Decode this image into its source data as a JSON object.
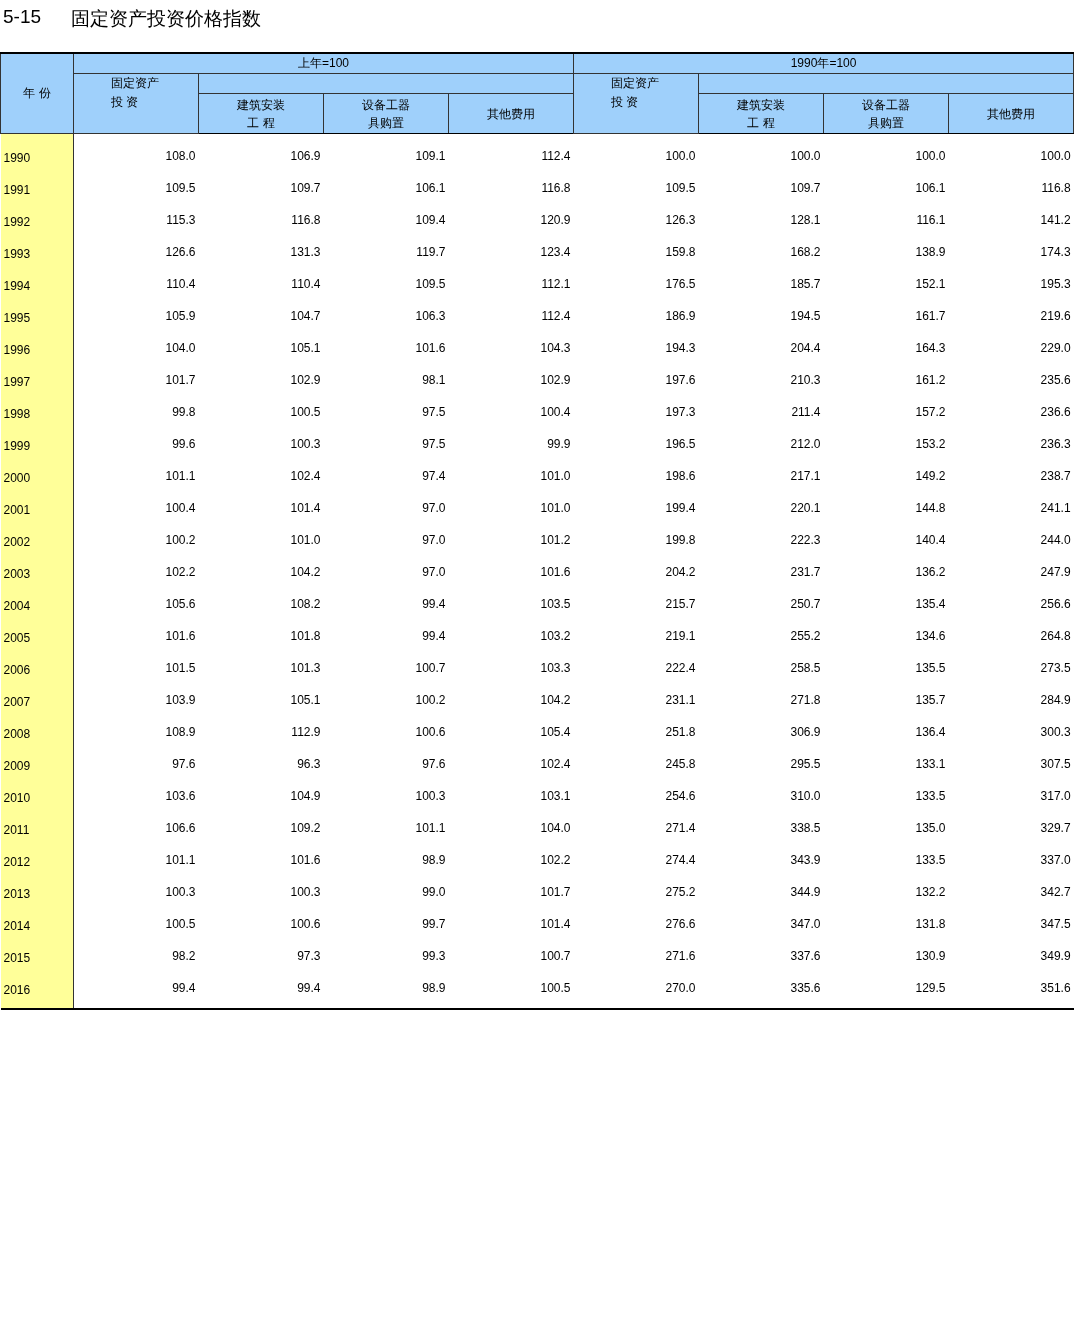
{
  "title": {
    "number": "5-15",
    "text": "固定资产投资价格指数"
  },
  "table": {
    "row_header": "年 份",
    "groups": [
      {
        "label": "上年=100",
        "columns": [
          [
            "固定资产",
            "投 资"
          ],
          [
            "建筑安装",
            "工 程"
          ],
          [
            "设备工器",
            "具购置"
          ],
          [
            "其他费用"
          ]
        ]
      },
      {
        "label": "1990年=100",
        "columns": [
          [
            "固定资产",
            "投 资"
          ],
          [
            "建筑安装",
            "工 程"
          ],
          [
            "设备工器",
            "具购置"
          ],
          [
            "其他费用"
          ]
        ]
      }
    ],
    "rows": [
      {
        "year": "1990",
        "values": [
          "108.0",
          "106.9",
          "109.1",
          "112.4",
          "100.0",
          "100.0",
          "100.0",
          "100.0"
        ]
      },
      {
        "year": "1991",
        "values": [
          "109.5",
          "109.7",
          "106.1",
          "116.8",
          "109.5",
          "109.7",
          "106.1",
          "116.8"
        ]
      },
      {
        "year": "1992",
        "values": [
          "115.3",
          "116.8",
          "109.4",
          "120.9",
          "126.3",
          "128.1",
          "116.1",
          "141.2"
        ]
      },
      {
        "year": "1993",
        "values": [
          "126.6",
          "131.3",
          "119.7",
          "123.4",
          "159.8",
          "168.2",
          "138.9",
          "174.3"
        ]
      },
      {
        "year": "1994",
        "values": [
          "110.4",
          "110.4",
          "109.5",
          "112.1",
          "176.5",
          "185.7",
          "152.1",
          "195.3"
        ]
      },
      {
        "year": "1995",
        "values": [
          "105.9",
          "104.7",
          "106.3",
          "112.4",
          "186.9",
          "194.5",
          "161.7",
          "219.6"
        ]
      },
      {
        "year": "1996",
        "values": [
          "104.0",
          "105.1",
          "101.6",
          "104.3",
          "194.3",
          "204.4",
          "164.3",
          "229.0"
        ]
      },
      {
        "year": "1997",
        "values": [
          "101.7",
          "102.9",
          "98.1",
          "102.9",
          "197.6",
          "210.3",
          "161.2",
          "235.6"
        ]
      },
      {
        "year": "1998",
        "values": [
          "99.8",
          "100.5",
          "97.5",
          "100.4",
          "197.3",
          "211.4",
          "157.2",
          "236.6"
        ]
      },
      {
        "year": "1999",
        "values": [
          "99.6",
          "100.3",
          "97.5",
          "99.9",
          "196.5",
          "212.0",
          "153.2",
          "236.3"
        ]
      },
      {
        "year": "2000",
        "values": [
          "101.1",
          "102.4",
          "97.4",
          "101.0",
          "198.6",
          "217.1",
          "149.2",
          "238.7"
        ]
      },
      {
        "year": "2001",
        "values": [
          "100.4",
          "101.4",
          "97.0",
          "101.0",
          "199.4",
          "220.1",
          "144.8",
          "241.1"
        ]
      },
      {
        "year": "2002",
        "values": [
          "100.2",
          "101.0",
          "97.0",
          "101.2",
          "199.8",
          "222.3",
          "140.4",
          "244.0"
        ]
      },
      {
        "year": "2003",
        "values": [
          "102.2",
          "104.2",
          "97.0",
          "101.6",
          "204.2",
          "231.7",
          "136.2",
          "247.9"
        ]
      },
      {
        "year": "2004",
        "values": [
          "105.6",
          "108.2",
          "99.4",
          "103.5",
          "215.7",
          "250.7",
          "135.4",
          "256.6"
        ]
      },
      {
        "year": "2005",
        "values": [
          "101.6",
          "101.8",
          "99.4",
          "103.2",
          "219.1",
          "255.2",
          "134.6",
          "264.8"
        ]
      },
      {
        "year": "2006",
        "values": [
          "101.5",
          "101.3",
          "100.7",
          "103.3",
          "222.4",
          "258.5",
          "135.5",
          "273.5"
        ]
      },
      {
        "year": "2007",
        "values": [
          "103.9",
          "105.1",
          "100.2",
          "104.2",
          "231.1",
          "271.8",
          "135.7",
          "284.9"
        ]
      },
      {
        "year": "2008",
        "values": [
          "108.9",
          "112.9",
          "100.6",
          "105.4",
          "251.8",
          "306.9",
          "136.4",
          "300.3"
        ]
      },
      {
        "year": "2009",
        "values": [
          "97.6",
          "96.3",
          "97.6",
          "102.4",
          "245.8",
          "295.5",
          "133.1",
          "307.5"
        ]
      },
      {
        "year": "2010",
        "values": [
          "103.6",
          "104.9",
          "100.3",
          "103.1",
          "254.6",
          "310.0",
          "133.5",
          "317.0"
        ]
      },
      {
        "year": "2011",
        "values": [
          "106.6",
          "109.2",
          "101.1",
          "104.0",
          "271.4",
          "338.5",
          "135.0",
          "329.7"
        ]
      },
      {
        "year": "2012",
        "values": [
          "101.1",
          "101.6",
          "98.9",
          "102.2",
          "274.4",
          "343.9",
          "133.5",
          "337.0"
        ]
      },
      {
        "year": "2013",
        "values": [
          "100.3",
          "100.3",
          "99.0",
          "101.7",
          "275.2",
          "344.9",
          "132.2",
          "342.7"
        ]
      },
      {
        "year": "2014",
        "values": [
          "100.5",
          "100.6",
          "99.7",
          "101.4",
          "276.6",
          "347.0",
          "131.8",
          "347.5"
        ]
      },
      {
        "year": "2015",
        "values": [
          "98.2",
          "97.3",
          "99.3",
          "100.7",
          "271.6",
          "337.6",
          "130.9",
          "349.9"
        ]
      },
      {
        "year": "2016",
        "values": [
          "99.4",
          "99.4",
          "98.9",
          "100.5",
          "270.0",
          "335.6",
          "129.5",
          "351.6"
        ]
      }
    ]
  }
}
